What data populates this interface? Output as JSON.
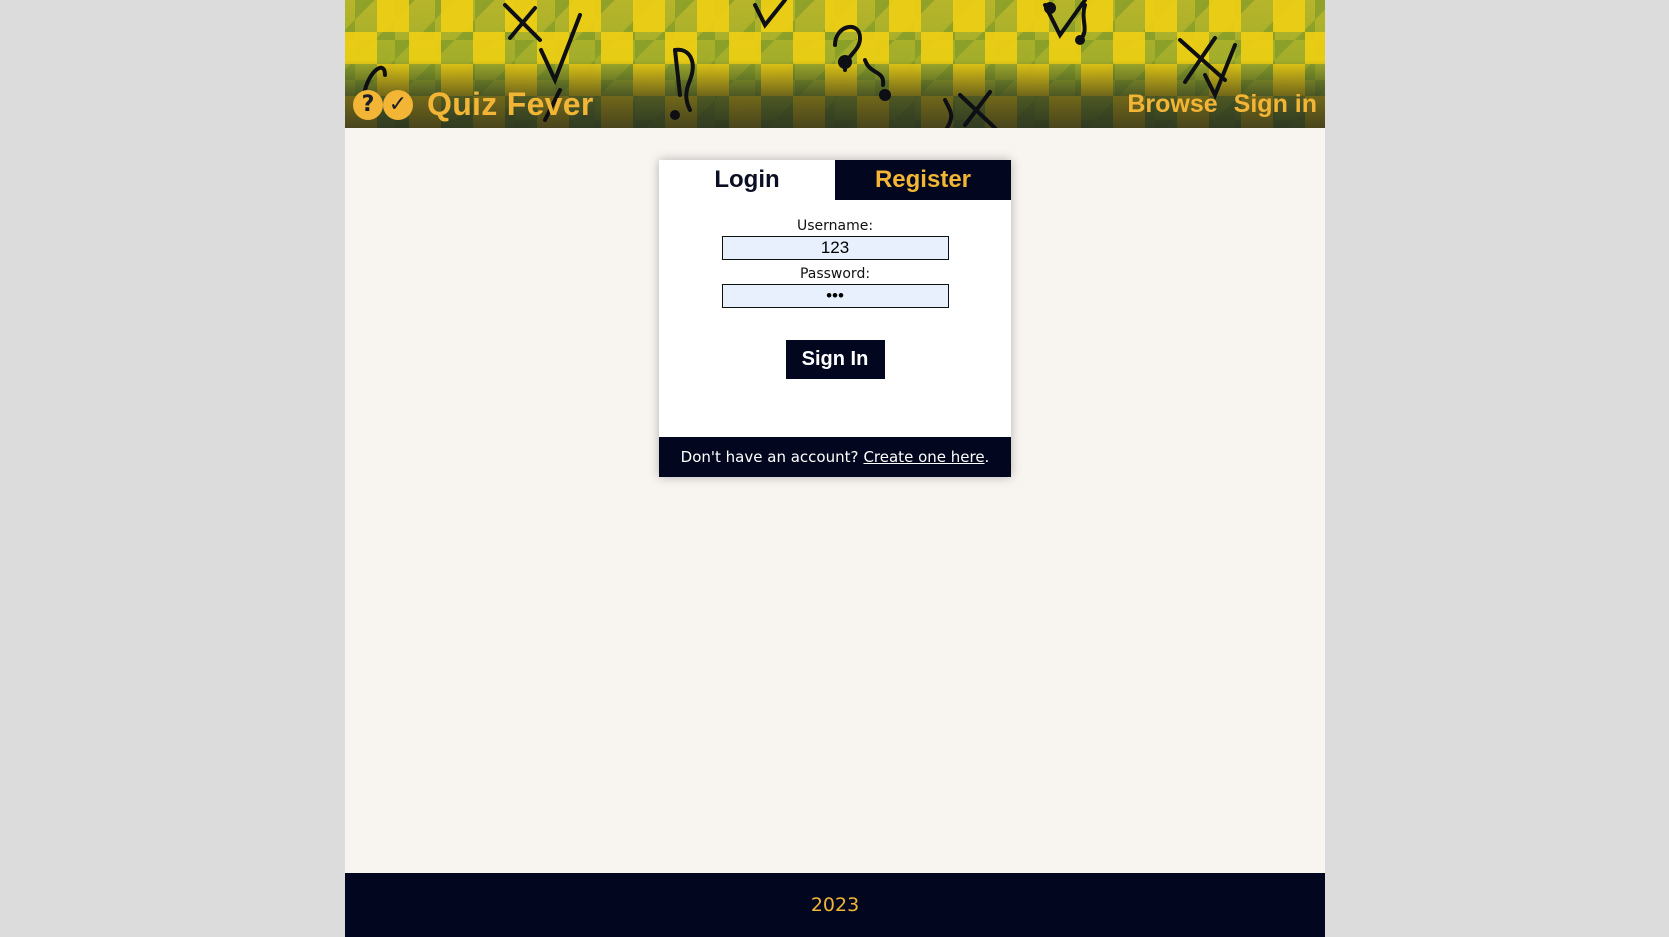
{
  "header": {
    "logo_icon_left": "question-circle-icon",
    "logo_icon_right": "check-circle-icon",
    "logo_glyph_left": "?",
    "logo_glyph_right": "✓",
    "title": "Quiz Fever",
    "nav": {
      "browse": "Browse",
      "sign_in": "Sign in"
    }
  },
  "login_card": {
    "tabs": {
      "login": "Login",
      "register": "Register"
    },
    "username": {
      "label": "Username:",
      "value": "123"
    },
    "password": {
      "label": "Password:",
      "value": "123"
    },
    "submit_label": "Sign In",
    "footer": {
      "text": "Don't have an account?",
      "link": "Create one here",
      "suffix": "."
    }
  },
  "site_footer": {
    "year": "2023"
  },
  "colors": {
    "accent": "#f2b535",
    "navy": "#02071f",
    "page_bg": "#f8f5f1",
    "input_bg": "#e8f0fe"
  }
}
